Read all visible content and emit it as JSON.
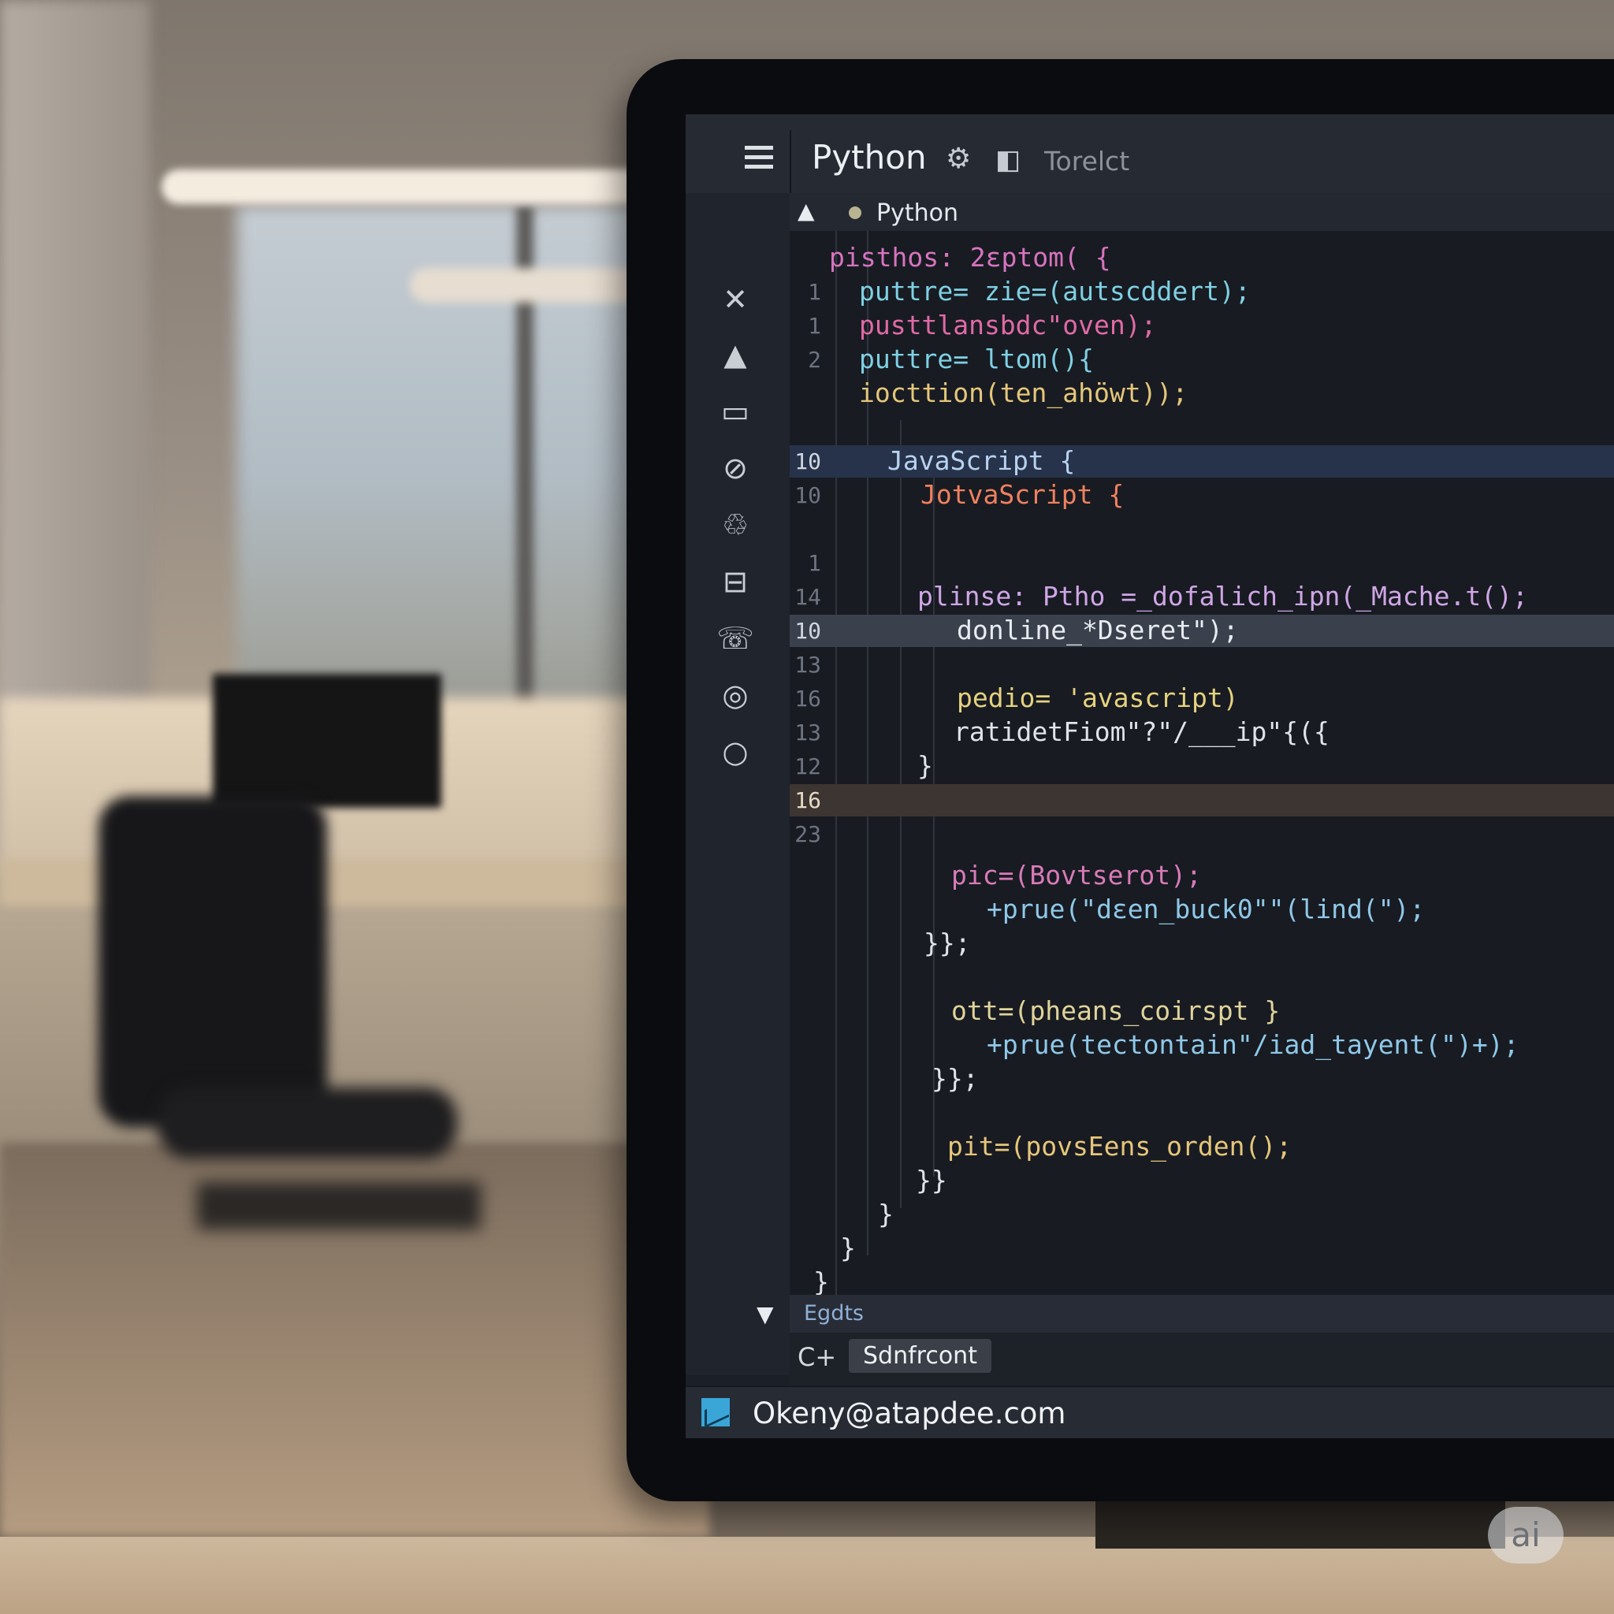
{
  "window": {
    "title": "Python",
    "menu_text": "Torelct"
  },
  "tab": {
    "label": "Python"
  },
  "activity_icons": [
    "close-icon",
    "warning-icon",
    "screen-icon",
    "blocked-icon",
    "recycle-icon",
    "archive-icon",
    "chat-icon",
    "target-icon",
    "circle-icon"
  ],
  "code_lines": [
    {
      "ln": "",
      "text": "pisthos: 2ɛptom( {",
      "color": "#d774bf",
      "indent": 50,
      "hl": ""
    },
    {
      "ln": "1",
      "text": "puttre= zie=(autscddert);",
      "color": "#7fd0e3",
      "indent": 88,
      "hl": ""
    },
    {
      "ln": "1",
      "text": "pusttlansbdc\"oven);",
      "color": "#e06aa6",
      "indent": 88,
      "hl": ""
    },
    {
      "ln": "2",
      "text": "puttre= ltom(){",
      "color": "#7fd0e3",
      "indent": 88,
      "hl": ""
    },
    {
      "ln": "",
      "text": "iocttion(ten_ahöwt));",
      "color": "#e5c77a",
      "indent": 88,
      "hl": ""
    },
    {
      "ln": "",
      "text": "",
      "color": "#ffffff",
      "indent": 88,
      "hl": ""
    },
    {
      "ln": "10",
      "text": "JavaScript {",
      "color": "#b7d2f0",
      "indent": 124,
      "hl": "blue"
    },
    {
      "ln": "10",
      "text": "JotvaScript {",
      "color": "#f0815f",
      "indent": 166,
      "hl": ""
    },
    {
      "ln": "",
      "text": "",
      "color": "#ffffff",
      "indent": 166,
      "hl": ""
    },
    {
      "ln": "1",
      "text": "",
      "color": "#ffffff",
      "indent": 166,
      "hl": ""
    },
    {
      "ln": "14",
      "text": "plinse: Ptho =_dofalich_ipn(_Mache.t();",
      "color": "#cfa6e6",
      "indent": 162,
      "hl": ""
    },
    {
      "ln": "10",
      "text": "donline_*Dseret\");",
      "color": "#e8ecf2",
      "indent": 212,
      "hl": "gray"
    },
    {
      "ln": "13",
      "text": "",
      "color": "#ffffff",
      "indent": 212,
      "hl": ""
    },
    {
      "ln": "16",
      "text": "pedio= 'avascript)",
      "color": "#e5d27f",
      "indent": 212,
      "hl": ""
    },
    {
      "ln": "13",
      "text": "ratidetFiom\"?\"/___ip\"{({",
      "color": "#dfe3ea",
      "indent": 208,
      "hl": ""
    },
    {
      "ln": "12",
      "text": "}",
      "color": "#dfe3ea",
      "indent": 162,
      "hl": ""
    },
    {
      "ln": "16",
      "text": "",
      "color": "#ffffff",
      "indent": 162,
      "hl": "orange"
    },
    {
      "ln": "23",
      "text": "",
      "color": "#ffffff",
      "indent": 162,
      "hl": ""
    }
  ],
  "code_lines_lower": [
    {
      "text": "pic=(Bovtserot);",
      "color": "#d87bb8",
      "indent": 205
    },
    {
      "text": "+prue(\"dɛen_buck0\"\"(lind(\");",
      "color": "#8fc8e8",
      "indent": 250
    },
    {
      "text": "}};",
      "color": "#dfe3ea",
      "indent": 170
    },
    {
      "text": "",
      "color": "#ffffff",
      "indent": 170
    },
    {
      "text": "ott=(pheans_coirspt }",
      "color": "#e0d49b",
      "indent": 205
    },
    {
      "text": "+prue(tectontain\"/iad_tayent(\")+);",
      "color": "#8fc8e8",
      "indent": 250
    },
    {
      "text": "}};",
      "color": "#dfe3ea",
      "indent": 180
    },
    {
      "text": "",
      "color": "#ffffff",
      "indent": 180
    },
    {
      "text": "pit=(povsEens_orden();",
      "color": "#e6c67a",
      "indent": 200
    },
    {
      "text": "}}",
      "color": "#dfe3ea",
      "indent": 160
    },
    {
      "text": "}",
      "color": "#dfe3ea",
      "indent": 112
    },
    {
      "text": "}",
      "color": "#dfe3ea",
      "indent": 64
    },
    {
      "text": "}",
      "color": "#dfe3ea",
      "indent": 30
    }
  ],
  "bottom_panel": {
    "label": "Egdts",
    "lang_button": "C+",
    "action_button": "Sdnfrcont"
  },
  "status": {
    "email": "Okeny@atapdee.com"
  },
  "watermark": "ai"
}
